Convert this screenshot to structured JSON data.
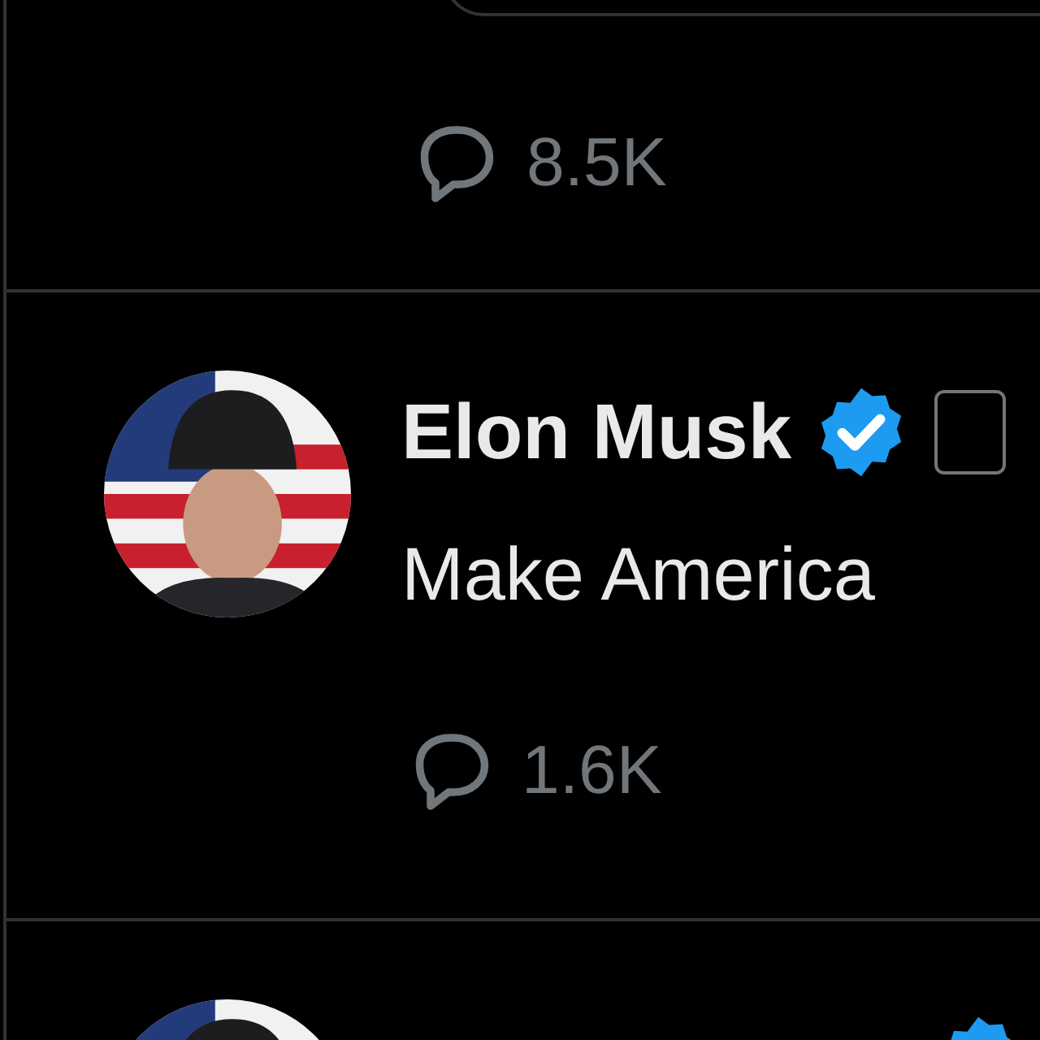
{
  "posts": [
    {
      "reply_count": "8.5K"
    },
    {
      "author": "Elon Musk",
      "verified": true,
      "text": "Make America",
      "reply_count": "1.6K"
    },
    {
      "verified": true
    }
  ]
}
